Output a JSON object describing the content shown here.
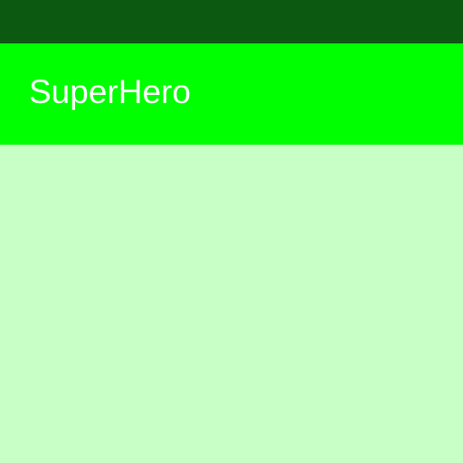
{
  "app_bar": {
    "title": "SuperHero"
  },
  "colors": {
    "status_bar": "#0c5912",
    "app_bar": "#00ff00",
    "title_text": "#ffffff",
    "content_background": "#c8ffc6"
  }
}
